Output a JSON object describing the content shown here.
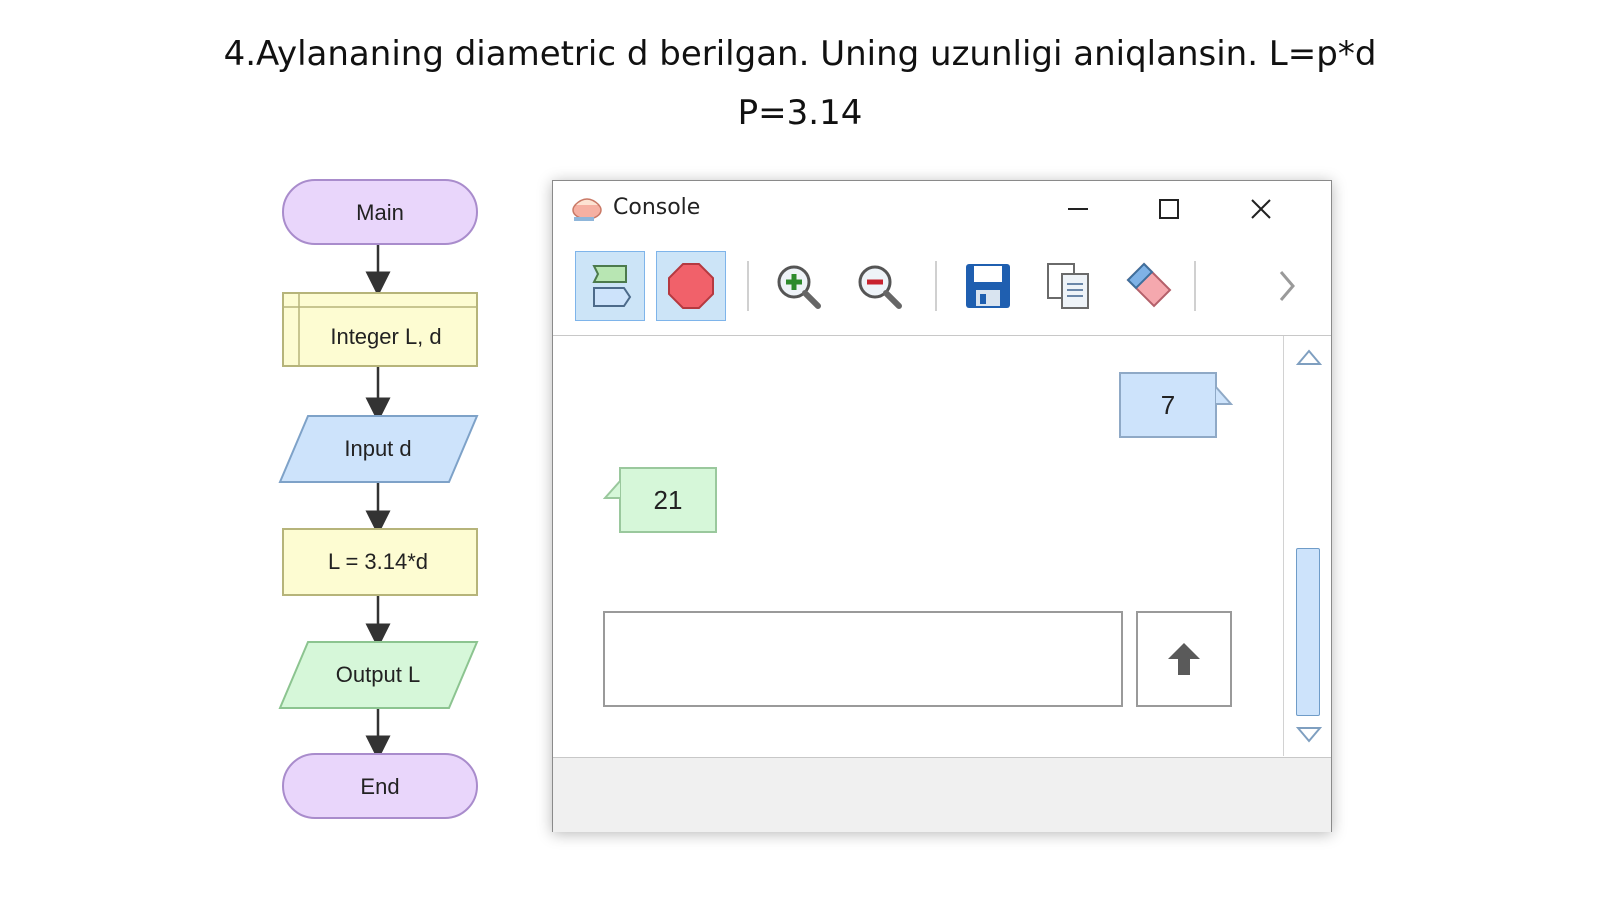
{
  "heading": {
    "line1": "4.Aylananing diametric d berilgan. Uning uzunligi aniqlansin. L=p*d",
    "line2": "P=3.14"
  },
  "flowchart": {
    "start": "Main",
    "declare": "Integer L, d",
    "input": "Input d",
    "assign": "L = 3.14*d",
    "output": "Output L",
    "end": "End"
  },
  "console_window": {
    "title": "Console",
    "titlebar_icons": [
      "minimize-icon",
      "maximize-icon",
      "close-icon"
    ],
    "toolbar_icons": [
      "run-icon",
      "stop-icon",
      "zoom-in-icon",
      "zoom-out-icon",
      "save-icon",
      "copy-icon",
      "eraser-icon",
      "chevron-right-icon"
    ],
    "messages": {
      "input_value": "7",
      "output_value": "21"
    },
    "input": {
      "value": "",
      "placeholder": ""
    },
    "send_icon": "arrow-up-icon"
  },
  "colors": {
    "terminal_fill": "#e9d6fb",
    "declare_fill": "#fdfcd2",
    "input_fill": "#cde3fb",
    "assign_fill": "#fdfcd2",
    "output_fill": "#d6f7d9",
    "stop_red": "#f1616a"
  }
}
